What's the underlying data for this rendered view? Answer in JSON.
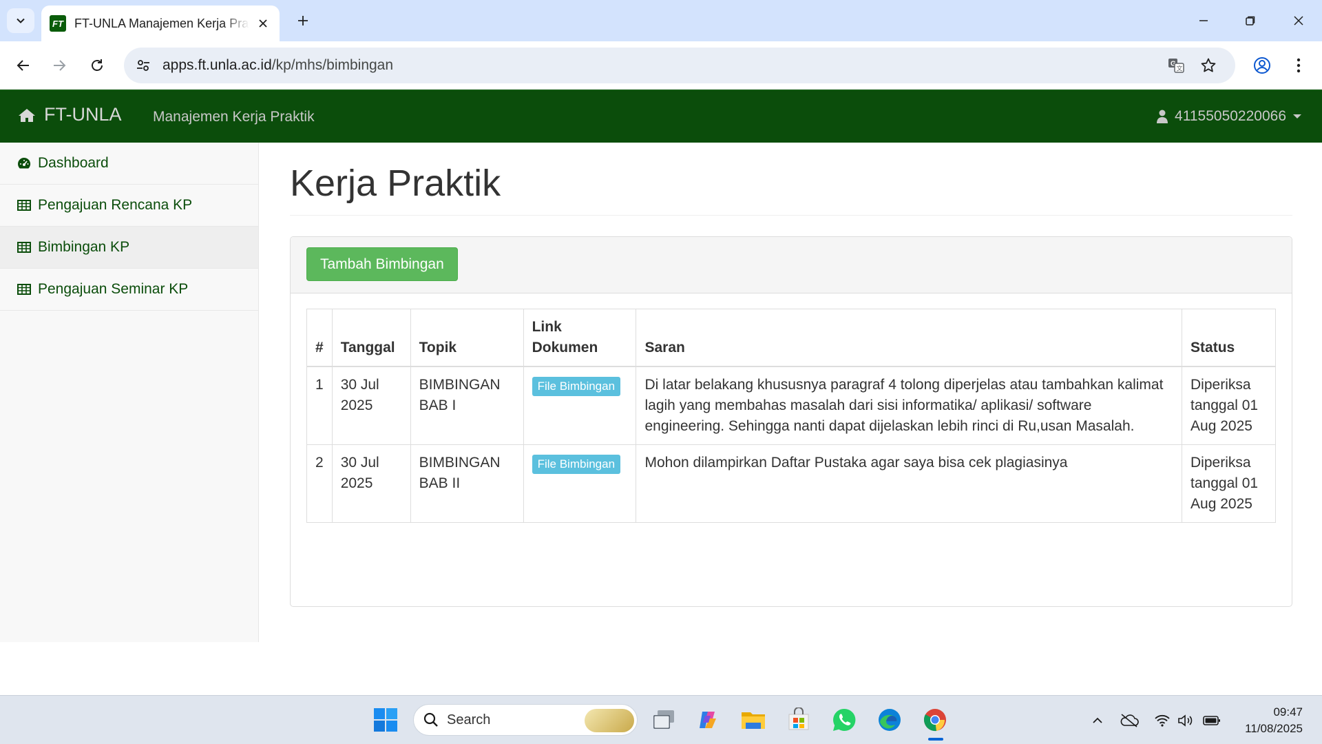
{
  "browser": {
    "tab_title": "FT-UNLA Manajemen Kerja Praktik",
    "favicon_text": "FT",
    "url_host": "apps.ft.unla.ac.id",
    "url_path": "/kp/mhs/bimbingan"
  },
  "navbar": {
    "brand": "FT-UNLA",
    "link": "Manajemen Kerja Praktik",
    "user": "41155050220066",
    "color": "#0b4d0b"
  },
  "sidebar": {
    "items": [
      {
        "label": "Dashboard",
        "icon": "dashboard-icon"
      },
      {
        "label": "Pengajuan Rencana KP",
        "icon": "table-icon"
      },
      {
        "label": "Bimbingan KP",
        "icon": "table-icon"
      },
      {
        "label": "Pengajuan Seminar KP",
        "icon": "table-icon"
      }
    ],
    "active_index": 2
  },
  "main": {
    "title": "Kerja Praktik",
    "add_button": "Tambah Bimbingan",
    "table": {
      "headers": [
        "#",
        "Tanggal",
        "Topik",
        "Link Dokumen",
        "Saran",
        "Status"
      ],
      "rows": [
        {
          "no": "1",
          "tanggal": "30 Jul 2025",
          "topik": "BIMBINGAN BAB I",
          "link": "File Bimbingan",
          "saran": "Di latar belakang khususnya paragraf 4 tolong diperjelas atau tambahkan kalimat lagih yang membahas masalah dari sisi informatika/ aplikasi/ software engineering. Sehingga nanti dapat dijelaskan lebih rinci di Ru,usan Masalah.",
          "status": "Diperiksa tanggal 01 Aug 2025"
        },
        {
          "no": "2",
          "tanggal": "30 Jul 2025",
          "topik": "BIMBINGAN BAB II",
          "link": "File Bimbingan",
          "saran": "Mohon dilampirkan Daftar Pustaka agar saya bisa cek plagiasinya",
          "status": "Diperiksa tanggal 01 Aug 2025"
        }
      ]
    }
  },
  "taskbar": {
    "search_placeholder": "Search",
    "time": "09:47",
    "date": "11/08/2025"
  }
}
